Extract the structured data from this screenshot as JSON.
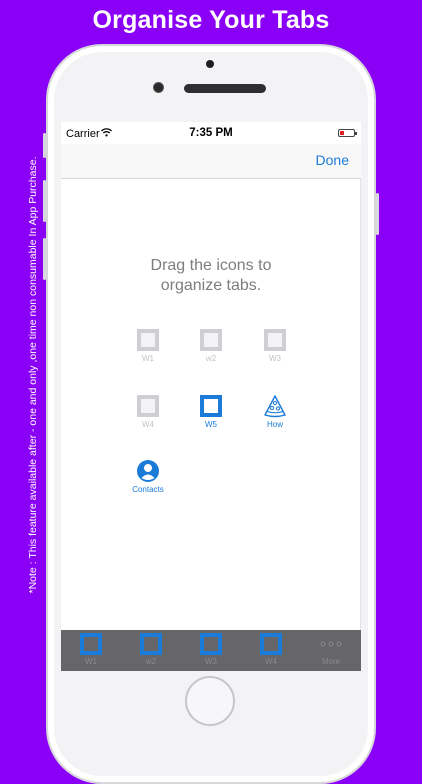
{
  "banner": {
    "title": "Organise Your Tabs"
  },
  "side_note": "*Note : This feature available after - one and only ,one time non consumable In App Purchase.",
  "status_bar": {
    "carrier": "Carrier",
    "time": "7:35 PM",
    "battery_color": "#e02020"
  },
  "nav": {
    "done_label": "Done"
  },
  "instruction": {
    "line1": "Drag the icons to",
    "line2": "organize tabs."
  },
  "grid_items": [
    {
      "label": "W1",
      "icon": "window-icon",
      "active": false
    },
    {
      "label": "w2",
      "icon": "window-icon",
      "active": false
    },
    {
      "label": "W3",
      "icon": "window-icon",
      "active": false
    },
    {
      "label": "W4",
      "icon": "window-icon",
      "active": false
    },
    {
      "label": "W5",
      "icon": "window-icon",
      "active": true
    },
    {
      "label": "How",
      "icon": "pizza-slice-icon",
      "active": true
    },
    {
      "label": "Contacts",
      "icon": "contact-person-icon",
      "active": true
    }
  ],
  "tab_bar": {
    "items": [
      {
        "label": "W1",
        "icon": "window-icon"
      },
      {
        "label": "w2",
        "icon": "window-icon"
      },
      {
        "label": "W3",
        "icon": "window-icon"
      },
      {
        "label": "W4",
        "icon": "window-icon"
      },
      {
        "label": "More",
        "icon": "more-dots-icon"
      }
    ]
  },
  "colors": {
    "background": "#8a00f7",
    "accent": "#1a7bd8",
    "inactive": "#c3c3c7",
    "tab_bar": "#666669"
  }
}
